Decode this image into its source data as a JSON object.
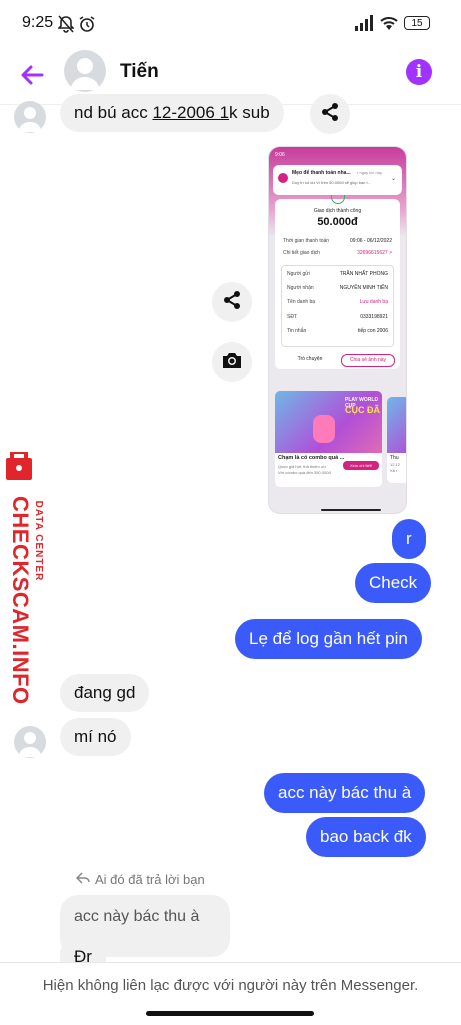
{
  "status_bar": {
    "time": "9:25",
    "battery": "15"
  },
  "header": {
    "contact_name": "Tiến"
  },
  "messages": {
    "m1_prefix": "nd bú acc ",
    "m1_underlined": "12-2006 1",
    "m1_suffix": "k sub",
    "r": "r",
    "check": "Check",
    "low_battery": "Lẹ để log gần hết pin",
    "dang_gd": "đang gd",
    "mi_no": "mí nó",
    "acc_nay": "acc này bác thu à",
    "bao_back": "bao back đk",
    "reply_label": "Ai đó đã trả lời bạn",
    "quoted": "acc này bác thu à",
    "dr": "Đr"
  },
  "screenshot": {
    "status_time": "9:06",
    "notif_title": "Mẹo để thanh toán nha...",
    "notif_time": "• ngay lúc này",
    "notif_body": "Duy trì số dư Ví trên 50.000đ sẽ giúp bạn t...",
    "success": "Giao dịch thành công",
    "amount": "50.000đ",
    "time_label": "Thời gian thanh toán",
    "time_value": "09:06 - 06/12/2022",
    "detail_label": "Chi tiết giao dịch",
    "detail_value": "32696615627 >",
    "sender_label": "Người gửi",
    "sender_value": "TRẦN NHẤT PHONG",
    "receiver_label": "Người nhận",
    "receiver_value": "NGUYỄN MINH TIẾN",
    "contacts_label": "Tên danh bạ",
    "contacts_value": "Lưu danh bạ",
    "phone_label": "SĐT",
    "phone_value": "0333198921",
    "msg_label": "Tin nhắn",
    "msg_value": "tiếp con 2006",
    "chat_btn": "Trò chuyện",
    "share_btn": "Chia sẻ ảnh này",
    "promo_title": "Chạm là có combo quà ...",
    "promo_sub1": "Quẹo giá hời, thả thiệm ưu",
    "promo_sub2": "Với combo quà đến 350.000đ",
    "promo_btn": "Xem chi tiết!",
    "promo_banner": "CỤC ĐÃ",
    "promo_banner_top": "PLAY WORLD CUP",
    "promo_side": "Thu",
    "promo_side_sub": "12.12",
    "promo_side_sub2": "Xã r"
  },
  "watermark": {
    "brand": "CHECKSCAM.INFO",
    "tag": "DATA CENTER"
  },
  "footer": {
    "text": "Hiện không liên lạc được với người này trên Messenger."
  },
  "colors": {
    "accent": "#a033ff",
    "outgoing": "#3a5bfa",
    "incoming": "#f0f0f0",
    "watermark": "#e0262b"
  }
}
